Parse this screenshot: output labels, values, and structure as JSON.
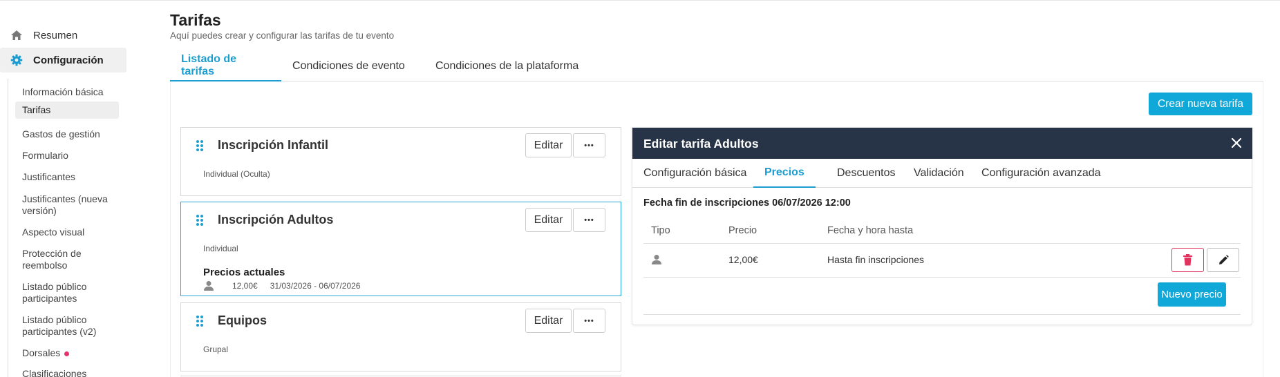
{
  "sidebar": {
    "main": [
      {
        "label": "Resumen",
        "icon": "home-icon"
      },
      {
        "label": "Configuración",
        "icon": "gear-icon"
      }
    ],
    "sub": [
      "Información básica",
      "Tarifas",
      "Gastos de gestión",
      "Formulario",
      "Justificantes",
      "Justificantes (nueva versión)",
      "Aspecto visual",
      "Protección de reembolso",
      "Listado público participantes",
      "Listado público participantes (v2)",
      "Dorsales",
      "Clasificaciones"
    ],
    "active_sub": "Tarifas"
  },
  "header": {
    "title": "Tarifas",
    "subtitle": "Aquí puedes crear y configurar las tarifas de tu evento"
  },
  "tabs": [
    "Listado de tarifas",
    "Condiciones de evento",
    "Condiciones de la plataforma"
  ],
  "active_tab": "Listado de tarifas",
  "create_button": "Crear nueva tarifa",
  "rates": [
    {
      "name": "Inscripción Infantil",
      "type": "Individual (Oculta)"
    },
    {
      "name": "Inscripción Adultos",
      "type": "Individual",
      "current_title": "Precios actuales",
      "current_price": "12,00€",
      "current_range": "31/03/2026 - 06/07/2026"
    },
    {
      "name": "Equipos",
      "type": "Grupal"
    }
  ],
  "edit_label": "Editar",
  "more_label": "•••",
  "edit_panel": {
    "title": "Editar tarifa Adultos",
    "tabs": [
      "Configuración básica",
      "Precios",
      "Descuentos",
      "Validación",
      "Configuración avanzada"
    ],
    "active_tab": "Precios",
    "deadline": "Fecha fin de inscripciones 06/07/2026 12:00",
    "columns": [
      "Tipo",
      "Precio",
      "Fecha y hora hasta"
    ],
    "row": {
      "type_icon": "person-icon",
      "price": "12,00€",
      "until": "Hasta fin inscripciones"
    },
    "new_price_button": "Nuevo precio"
  },
  "colors": {
    "accent": "#1b9dd0",
    "primary_button": "#0fa8d8",
    "panel_header": "#273448",
    "danger": "#e0335e",
    "badge_dot": "#e8336a"
  }
}
